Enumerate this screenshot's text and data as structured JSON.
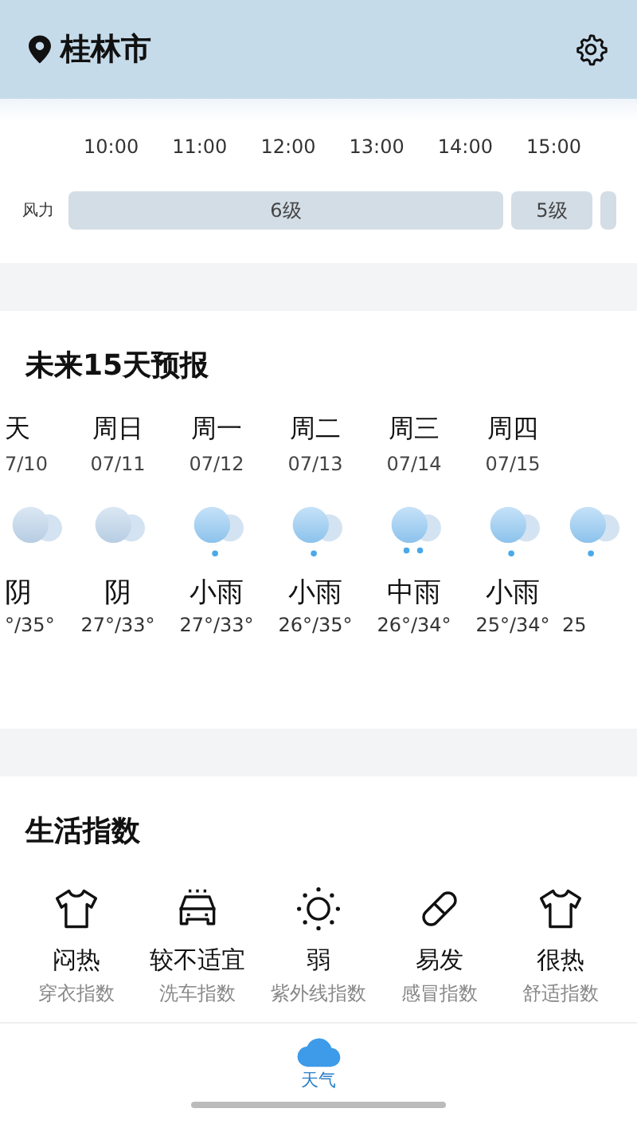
{
  "header": {
    "city": "桂林市"
  },
  "hourly": {
    "times": [
      "10:00",
      "11:00",
      "12:00",
      "13:00",
      "14:00",
      "15:00"
    ],
    "wind_label": "风力",
    "wind": [
      {
        "label": "6级"
      },
      {
        "label": "5级"
      }
    ]
  },
  "forecast": {
    "title": "未来15天预报",
    "days": [
      {
        "weekday": "天",
        "date": "7/10",
        "kind": "overcast",
        "condition": "阴",
        "temps": "°/35°"
      },
      {
        "weekday": "周日",
        "date": "07/11",
        "kind": "overcast",
        "condition": "阴",
        "temps": "27°/33°"
      },
      {
        "weekday": "周一",
        "date": "07/12",
        "kind": "light-rain",
        "condition": "小雨",
        "temps": "27°/33°"
      },
      {
        "weekday": "周二",
        "date": "07/13",
        "kind": "light-rain",
        "condition": "小雨",
        "temps": "26°/35°"
      },
      {
        "weekday": "周三",
        "date": "07/14",
        "kind": "moderate-rain",
        "condition": "中雨",
        "temps": "26°/34°"
      },
      {
        "weekday": "周四",
        "date": "07/15",
        "kind": "light-rain",
        "condition": "小雨",
        "temps": "25°/34°"
      },
      {
        "kind": "light-rain",
        "temps": "25"
      }
    ]
  },
  "life": {
    "title": "生活指数",
    "items": [
      {
        "kind": "shirt",
        "value": "闷热",
        "label": "穿衣指数"
      },
      {
        "kind": "car",
        "value": "较不适宜",
        "label": "洗车指数"
      },
      {
        "kind": "sun",
        "value": "弱",
        "label": "紫外线指数"
      },
      {
        "kind": "pill",
        "value": "易发",
        "label": "感冒指数"
      },
      {
        "kind": "shirt",
        "value": "很热",
        "label": "舒适指数"
      }
    ]
  },
  "tabbar": [
    {
      "label": "天气",
      "selected": true
    }
  ]
}
